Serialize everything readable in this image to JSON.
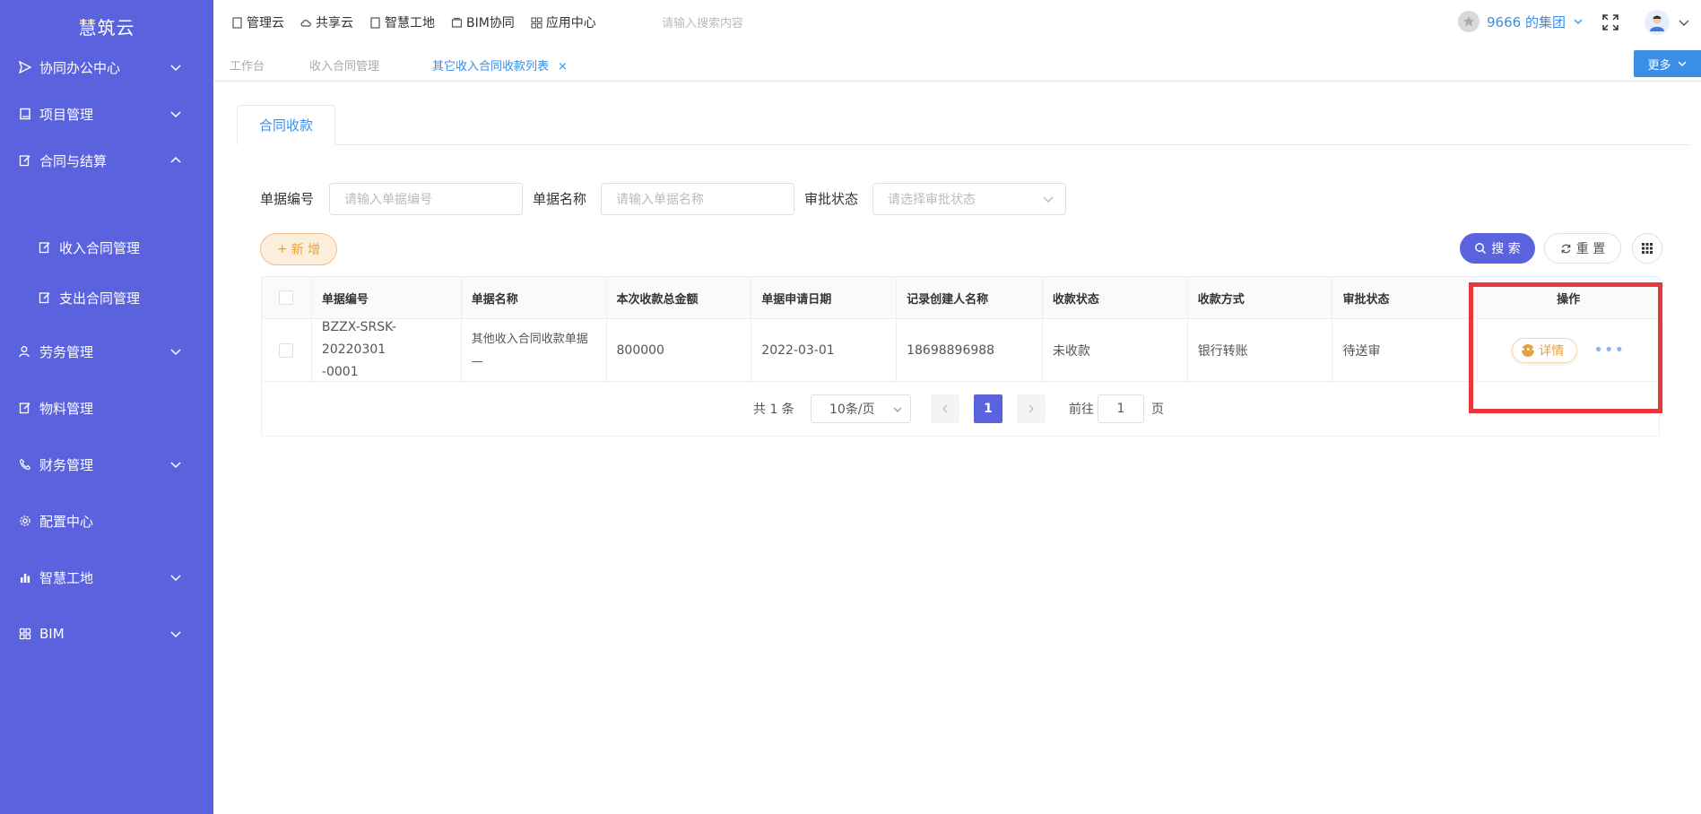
{
  "app": {
    "brand": "慧筑云"
  },
  "sidebar": {
    "items": [
      {
        "label": "协同办公中心",
        "icon": "send-icon",
        "chevron": "down"
      },
      {
        "label": "项目管理",
        "icon": "book-icon",
        "chevron": "down"
      },
      {
        "label": "合同与结算",
        "icon": "edit-icon",
        "chevron": "up"
      },
      {
        "label": "收入合同管理",
        "icon": "edit-icon"
      },
      {
        "label": "支出合同管理",
        "icon": "edit-icon"
      },
      {
        "label": "劳务管理",
        "icon": "users-icon",
        "chevron": "down"
      },
      {
        "label": "物料管理",
        "icon": "edit-icon"
      },
      {
        "label": "财务管理",
        "icon": "phone-icon",
        "chevron": "down"
      },
      {
        "label": "配置中心",
        "icon": "gear-icon"
      },
      {
        "label": "智慧工地",
        "icon": "bar-chart-icon",
        "chevron": "down"
      },
      {
        "label": "BIM",
        "icon": "grid-icon",
        "chevron": "down"
      }
    ]
  },
  "topbar": {
    "nav": [
      "管理云",
      "共享云",
      "智慧工地",
      "BIM协同",
      "应用中心"
    ],
    "search_placeholder": "请输入搜索内容",
    "group_name": "9666 的集团"
  },
  "tabs": {
    "items": [
      "工作台",
      "收入合同管理",
      "其它收入合同收款列表"
    ],
    "close": "×",
    "more": "更多"
  },
  "content": {
    "tab": "合同收款",
    "filters": {
      "code_label": "单据编号",
      "code_placeholder": "请输入单据编号",
      "name_label": "单据名称",
      "name_placeholder": "请输入单据名称",
      "status_label": "审批状态",
      "status_placeholder": "请选择审批状态"
    },
    "buttons": {
      "add": "新 增",
      "search": "搜 索",
      "reset": "重 置"
    },
    "table": {
      "headers": [
        "单据编号",
        "单据名称",
        "本次收款总金额",
        "单据申请日期",
        "记录创建人名称",
        "收款状态",
        "收款方式",
        "审批状态",
        "操作"
      ],
      "rows": [
        {
          "code_line1": "BZZX-SRSK-20220301",
          "code_line2": "-0001",
          "name_line1": "其他收入合同收款单据",
          "name_line2": "—",
          "amount": "800000",
          "date": "2022-03-01",
          "creator": "18698896988",
          "pay_status": "未收款",
          "pay_method": "银行转账",
          "approval": "待送审",
          "action": "详情"
        }
      ]
    },
    "pager": {
      "total": "共 1 条",
      "page_size": "10条/页",
      "current": "1",
      "goto_label": "前往",
      "goto_value": "1",
      "page_suffix": "页"
    }
  },
  "colors": {
    "sidebar": "#5b62dd",
    "accent": "#3a8ee6",
    "warning": "#e6a23c",
    "highlight": "#e8383d"
  }
}
